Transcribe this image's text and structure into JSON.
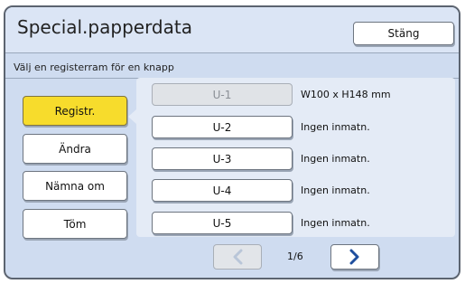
{
  "header": {
    "title": "Special.papperdata",
    "close_label": "Stäng"
  },
  "instruction": "Välj en registerram för en knapp",
  "side_buttons": [
    {
      "label": "Registr.",
      "active": true
    },
    {
      "label": "Ändra",
      "active": false
    },
    {
      "label": "Nämna om",
      "active": false
    },
    {
      "label": "Töm",
      "active": false
    }
  ],
  "registers": [
    {
      "label": "U-1",
      "value": "W100 x H148 mm",
      "enabled": false
    },
    {
      "label": "U-2",
      "value": "Ingen inmatn.",
      "enabled": true
    },
    {
      "label": "U-3",
      "value": "Ingen inmatn.",
      "enabled": true
    },
    {
      "label": "U-4",
      "value": "Ingen inmatn.",
      "enabled": true
    },
    {
      "label": "U-5",
      "value": "Ingen inmatn.",
      "enabled": true
    }
  ],
  "pager": {
    "page_text": "1/6",
    "prev_icon": "chevron-left-icon",
    "next_icon": "chevron-right-icon",
    "prev_enabled": false,
    "next_enabled": true
  },
  "colors": {
    "active_button": "#f7dc2c",
    "accent": "#1f4f9e",
    "background": "#cfdcf0"
  }
}
